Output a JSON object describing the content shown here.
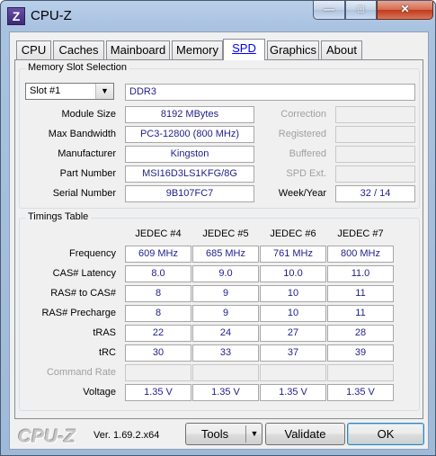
{
  "window": {
    "title": "CPU-Z",
    "app_icon": "Z"
  },
  "titlebar_buttons": {
    "minimize": "—",
    "maximize": "□",
    "close": "✕"
  },
  "tabs": [
    {
      "label": "CPU"
    },
    {
      "label": "Caches"
    },
    {
      "label": "Mainboard"
    },
    {
      "label": "Memory"
    },
    {
      "label": "SPD"
    },
    {
      "label": "Graphics"
    },
    {
      "label": "About"
    }
  ],
  "active_tab": "SPD",
  "slot_group": {
    "title": "Memory Slot Selection",
    "slot_selected": "Slot #1",
    "memory_type": "DDR3",
    "fields": {
      "module_size": {
        "label": "Module Size",
        "value": "8192 MBytes"
      },
      "max_bandwidth": {
        "label": "Max Bandwidth",
        "value": "PC3-12800 (800 MHz)"
      },
      "manufacturer": {
        "label": "Manufacturer",
        "value": "Kingston"
      },
      "part_number": {
        "label": "Part Number",
        "value": "MSI16D3LS1KFG/8G"
      },
      "serial_number": {
        "label": "Serial Number",
        "value": "9B107FC7"
      }
    },
    "right_fields": {
      "correction": {
        "label": "Correction",
        "value": ""
      },
      "registered": {
        "label": "Registered",
        "value": ""
      },
      "buffered": {
        "label": "Buffered",
        "value": ""
      },
      "spd_ext": {
        "label": "SPD Ext.",
        "value": ""
      },
      "week_year": {
        "label": "Week/Year",
        "value": "32 / 14"
      }
    }
  },
  "timings": {
    "title": "Timings Table",
    "columns": [
      "JEDEC #4",
      "JEDEC #5",
      "JEDEC #6",
      "JEDEC #7"
    ],
    "rows": [
      {
        "label": "Frequency",
        "values": [
          "609 MHz",
          "685 MHz",
          "761 MHz",
          "800 MHz"
        ],
        "dim": false
      },
      {
        "label": "CAS# Latency",
        "values": [
          "8.0",
          "9.0",
          "10.0",
          "11.0"
        ],
        "dim": false
      },
      {
        "label": "RAS# to CAS#",
        "values": [
          "8",
          "9",
          "10",
          "11"
        ],
        "dim": false
      },
      {
        "label": "RAS# Precharge",
        "values": [
          "8",
          "9",
          "10",
          "11"
        ],
        "dim": false
      },
      {
        "label": "tRAS",
        "values": [
          "22",
          "24",
          "27",
          "28"
        ],
        "dim": false
      },
      {
        "label": "tRC",
        "values": [
          "30",
          "33",
          "37",
          "39"
        ],
        "dim": false
      },
      {
        "label": "Command Rate",
        "values": [
          "",
          "",
          "",
          ""
        ],
        "dim": true
      },
      {
        "label": "Voltage",
        "values": [
          "1.35 V",
          "1.35 V",
          "1.35 V",
          "1.35 V"
        ],
        "dim": false
      }
    ]
  },
  "footer": {
    "logo": "CPU-Z",
    "version": "Ver. 1.69.2.x64",
    "tools_label": "Tools",
    "tools_arrow": "▼",
    "validate_label": "Validate",
    "ok_label": "OK"
  },
  "colors": {
    "value_text": "#1f1f8c",
    "active_tab_text": "#0000ff",
    "frame": "#a9c2e0"
  }
}
